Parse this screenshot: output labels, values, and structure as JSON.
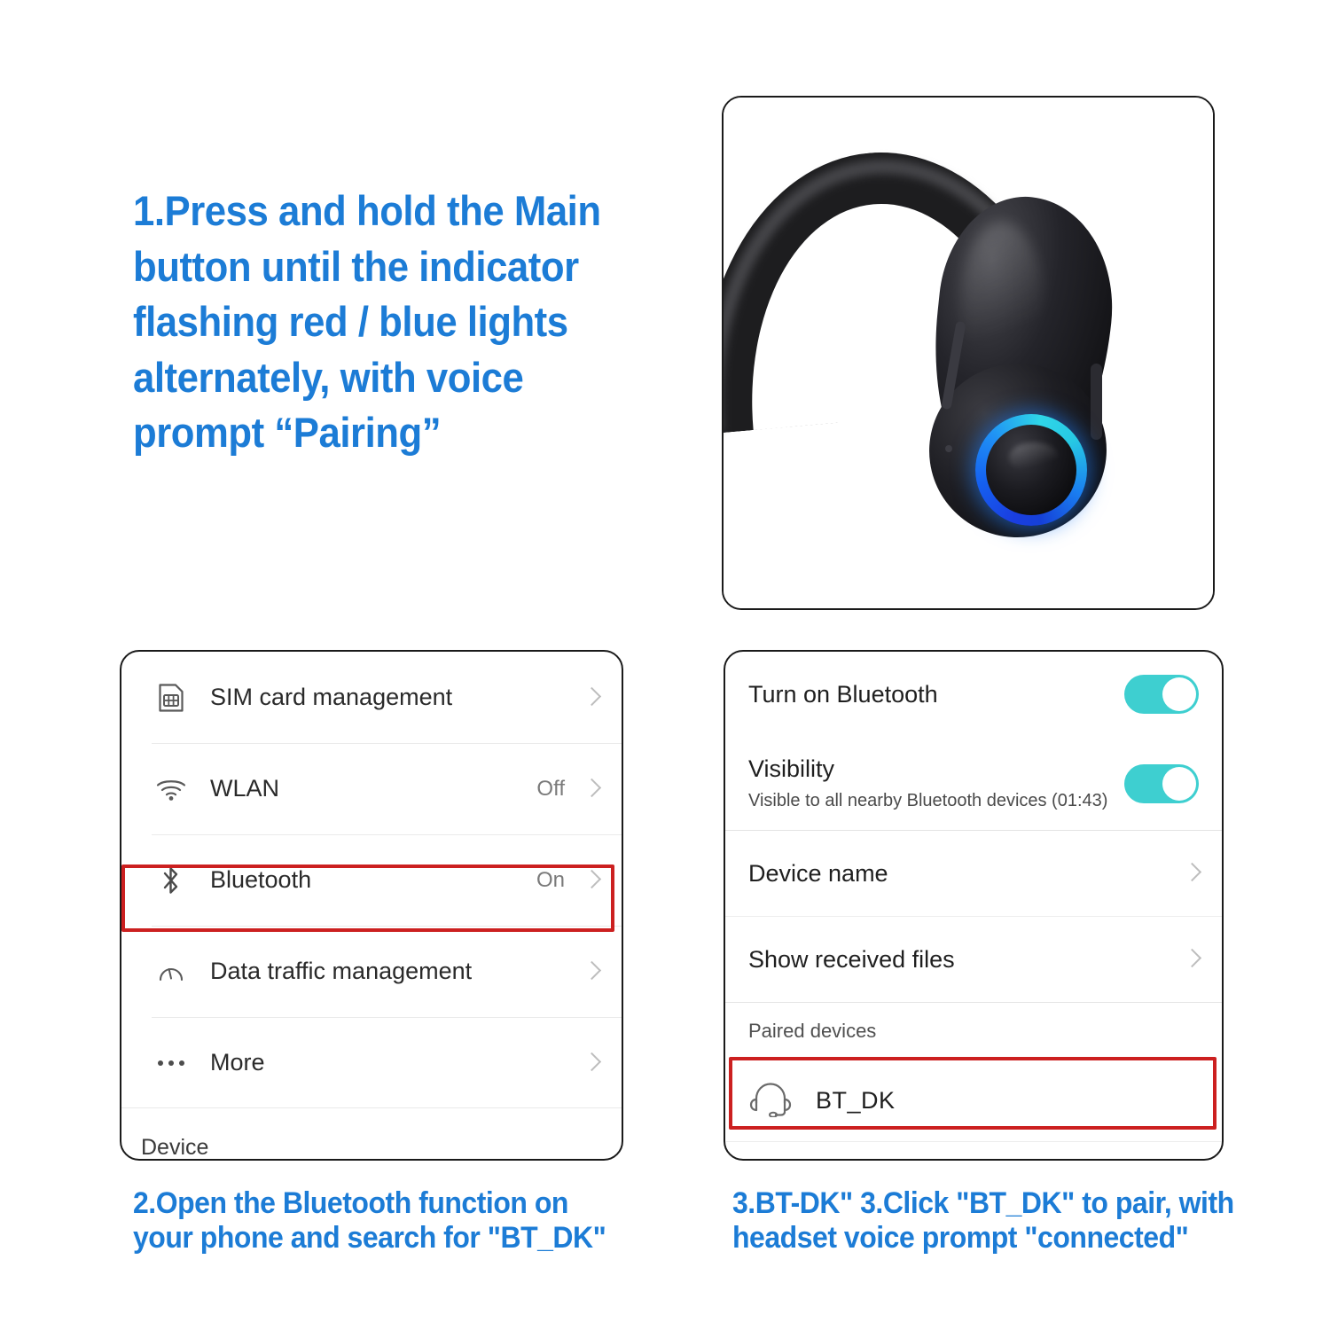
{
  "steps": {
    "step1": "1.Press and hold the Main button until the indicator flashing red / blue lights alternately, with voice prompt  “Pairing”",
    "step2": "2.Open the Bluetooth function on your phone and search for \"BT_DK\"",
    "step3": "3.BT-DK\" 3.Click \"BT_DK\" to pair, with headset voice prompt \"connected\""
  },
  "product_photo": {
    "alt": "bluetooth-earhook-headset",
    "button_ring_colors": [
      "#1a3ee0",
      "#1f8ff5",
      "#2fd6e8"
    ],
    "body_color": "#1d1d1f"
  },
  "settings_panel": {
    "rows": [
      {
        "icon": "sim-card-icon",
        "label": "SIM card management",
        "value": ""
      },
      {
        "icon": "wifi-icon",
        "label": "WLAN",
        "value": "Off"
      },
      {
        "icon": "bluetooth-icon",
        "label": "Bluetooth",
        "value": "On"
      },
      {
        "icon": "speedometer-icon",
        "label": "Data traffic management",
        "value": ""
      },
      {
        "icon": "more-dots-icon",
        "label": "More",
        "value": ""
      }
    ],
    "footer_label": "Device",
    "highlight_color": "#CC2020",
    "highlighted_row": "Bluetooth"
  },
  "bluetooth_panel": {
    "turn_on": {
      "label": "Turn on Bluetooth",
      "toggle_on": true
    },
    "visibility": {
      "label": "Visibility",
      "sublabel": "Visible to all nearby Bluetooth devices (01:43)",
      "toggle_on": true
    },
    "device_name": {
      "label": "Device name"
    },
    "show_received_files": {
      "label": "Show received files"
    },
    "paired_section_label": "Paired devices",
    "paired_devices": [
      {
        "icon": "headset-icon",
        "name": "BT_DK"
      }
    ],
    "toggle_color": "#3ECFD0",
    "highlight_color": "#CC2020",
    "highlighted_row": "BT_DK"
  }
}
